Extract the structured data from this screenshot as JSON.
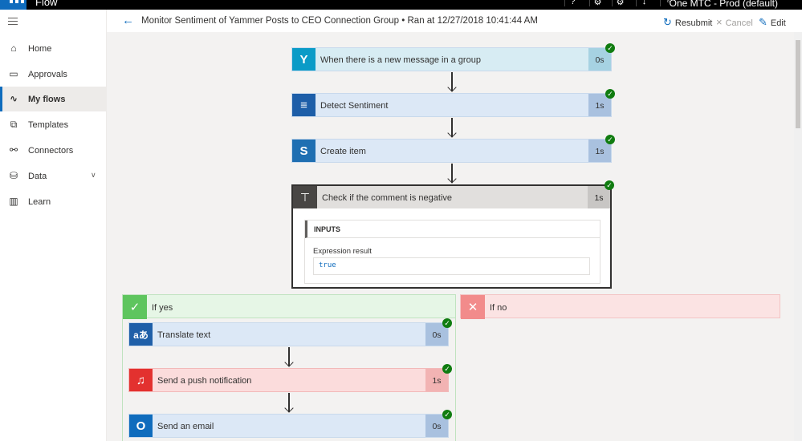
{
  "app": {
    "name": "Flow",
    "environment": "One MTC - Prod (default)"
  },
  "header": {
    "title": "Monitor Sentiment of Yammer Posts to CEO Connection Group • Ran at 12/27/2018 10:41:44 AM",
    "resubmit_label": "Resubmit",
    "cancel_label": "Cancel",
    "edit_label": "Edit"
  },
  "sidebar": {
    "items": [
      {
        "label": "Home",
        "icon": "home-icon"
      },
      {
        "label": "Approvals",
        "icon": "approvals-icon"
      },
      {
        "label": "My flows",
        "icon": "flow-icon",
        "active": true
      },
      {
        "label": "Templates",
        "icon": "templates-icon"
      },
      {
        "label": "Connectors",
        "icon": "connectors-icon"
      },
      {
        "label": "Data",
        "icon": "database-icon",
        "expandable": true
      },
      {
        "label": "Learn",
        "icon": "book-icon"
      }
    ]
  },
  "steps": [
    {
      "title": "When there is a new message in a group",
      "duration": "0s",
      "icon": "yammer-icon",
      "status": "succeeded"
    },
    {
      "title": "Detect Sentiment",
      "duration": "1s",
      "icon": "text-analytics-icon",
      "status": "succeeded"
    },
    {
      "title": "Create item",
      "duration": "1s",
      "icon": "sharepoint-icon",
      "status": "succeeded"
    }
  ],
  "condition": {
    "title": "Check if the comment is negative",
    "duration": "1s",
    "inputs_label": "INPUTS",
    "expression_label": "Expression result",
    "expression_value": "true",
    "status": "succeeded"
  },
  "branches": {
    "yes": {
      "label": "If yes",
      "steps": [
        {
          "title": "Translate text",
          "duration": "0s",
          "icon": "translator-icon",
          "status": "succeeded"
        },
        {
          "title": "Send a push notification",
          "duration": "1s",
          "icon": "notification-bell-icon",
          "status": "succeeded"
        },
        {
          "title": "Send an email",
          "duration": "0s",
          "icon": "outlook-icon",
          "status": "succeeded"
        }
      ]
    },
    "no": {
      "label": "If no"
    }
  },
  "colors": {
    "accent": "#0f6cbd",
    "yammer": "#0a9bc7",
    "sentiment": "#1d5ea8",
    "sharepoint": "#1f6fb2",
    "condition": "#484644",
    "success": "#107c10",
    "notification": "#e3312f",
    "outlook": "#0f6cbd"
  }
}
